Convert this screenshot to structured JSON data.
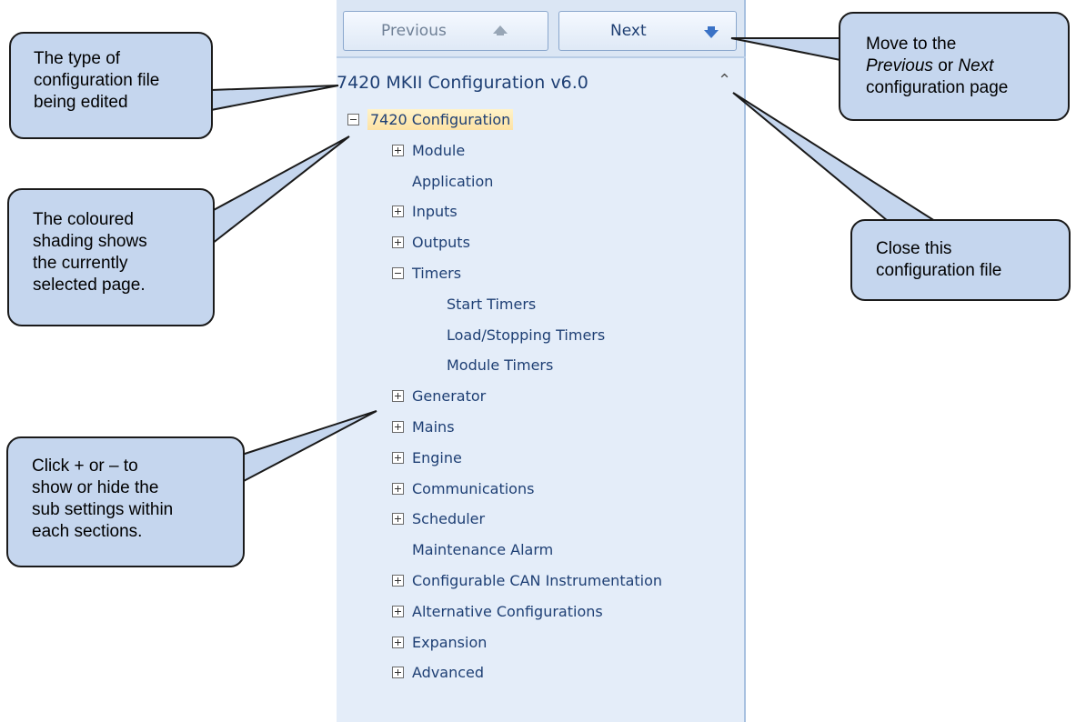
{
  "toolbar": {
    "previous_label": "Previous",
    "next_label": "Next"
  },
  "config": {
    "title": "7420 MKII Configuration v6.0",
    "collapse_icon": "double-chevron-up-icon"
  },
  "tree": [
    {
      "label": "7420 Configuration",
      "expander": "minus",
      "selected": true
    },
    {
      "label": "Module",
      "expander": "plus"
    },
    {
      "label": "Application",
      "expander": "none"
    },
    {
      "label": "Inputs",
      "expander": "plus"
    },
    {
      "label": "Outputs",
      "expander": "plus"
    },
    {
      "label": "Timers",
      "expander": "minus"
    },
    {
      "label": "Start Timers",
      "expander": "none"
    },
    {
      "label": "Load/Stopping Timers",
      "expander": "none"
    },
    {
      "label": "Module Timers",
      "expander": "none"
    },
    {
      "label": "Generator",
      "expander": "plus"
    },
    {
      "label": "Mains",
      "expander": "plus"
    },
    {
      "label": "Engine",
      "expander": "plus"
    },
    {
      "label": "Communications",
      "expander": "plus"
    },
    {
      "label": "Scheduler",
      "expander": "plus"
    },
    {
      "label": "Maintenance Alarm",
      "expander": "none"
    },
    {
      "label": "Configurable CAN Instrumentation",
      "expander": "plus"
    },
    {
      "label": "Alternative Configurations",
      "expander": "plus"
    },
    {
      "label": "Expansion",
      "expander": "plus"
    },
    {
      "label": "Advanced",
      "expander": "plus"
    }
  ],
  "callouts": {
    "file_type": [
      "The type of",
      "configuration file",
      "being edited"
    ],
    "shading": [
      "The coloured",
      "shading shows",
      "the currently",
      "selected page."
    ],
    "expand": [
      "Click + or – to",
      "show or hide the",
      "sub settings within",
      "each sections."
    ],
    "prev_next": {
      "line1": "Move to the",
      "prev_word": "Previous",
      "or_word": " or ",
      "next_word": "Next",
      "line3": "configuration page"
    },
    "close": [
      "Close this",
      "configuration file"
    ]
  },
  "colors": {
    "panel_bg": "#e4edf9",
    "tree_text": "#1e3f74",
    "callout_bg": "#c5d6ee",
    "selected_highlight": "#fde2a4"
  }
}
